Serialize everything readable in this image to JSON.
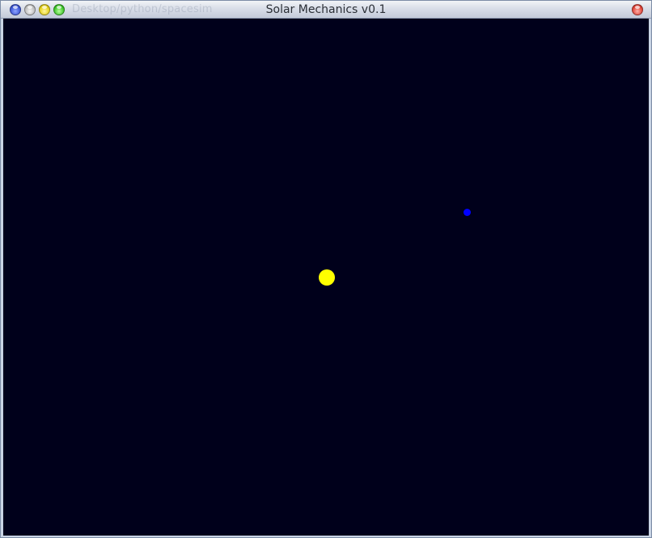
{
  "window": {
    "title": "Solar Mechanics v0.1",
    "background_path_text": "Desktop/python/spacesim"
  },
  "titlebar_buttons": [
    {
      "name": "blue",
      "color": "#3f58d6"
    },
    {
      "name": "grey",
      "color": "#bdbdbd"
    },
    {
      "name": "yellow",
      "color": "#e4d11d"
    },
    {
      "name": "green",
      "color": "#3ec62a"
    },
    {
      "name": "close",
      "color": "#e0473b"
    }
  ],
  "simulation": {
    "background_color": "#00001b",
    "bodies": [
      {
        "name": "sun",
        "color": "#ffff00"
      },
      {
        "name": "planet",
        "color": "#0000ff"
      }
    ]
  }
}
